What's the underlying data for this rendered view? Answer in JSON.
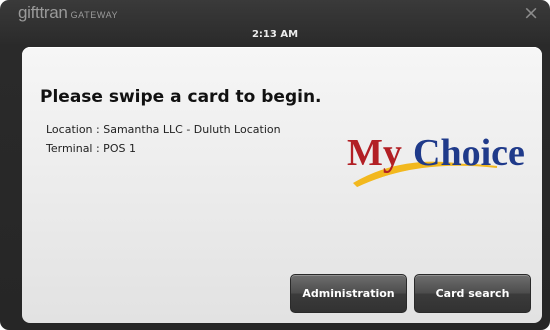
{
  "header": {
    "brand_main": "gifttran",
    "brand_sub": "GATEWAY",
    "time": "2:13 AM",
    "close_glyph": "×"
  },
  "main": {
    "prompt": "Please swipe a card to begin.",
    "location": "Location : Samantha LLC - Duluth Location",
    "terminal": "Terminal : POS 1"
  },
  "logo": {
    "text_my": "My",
    "text_choice": "Choice",
    "colors": {
      "my": "#b21f24",
      "choice": "#1f3a8a",
      "swoosh": "#f2b81e"
    }
  },
  "buttons": {
    "administration": "Administration",
    "card_search": "Card search"
  }
}
